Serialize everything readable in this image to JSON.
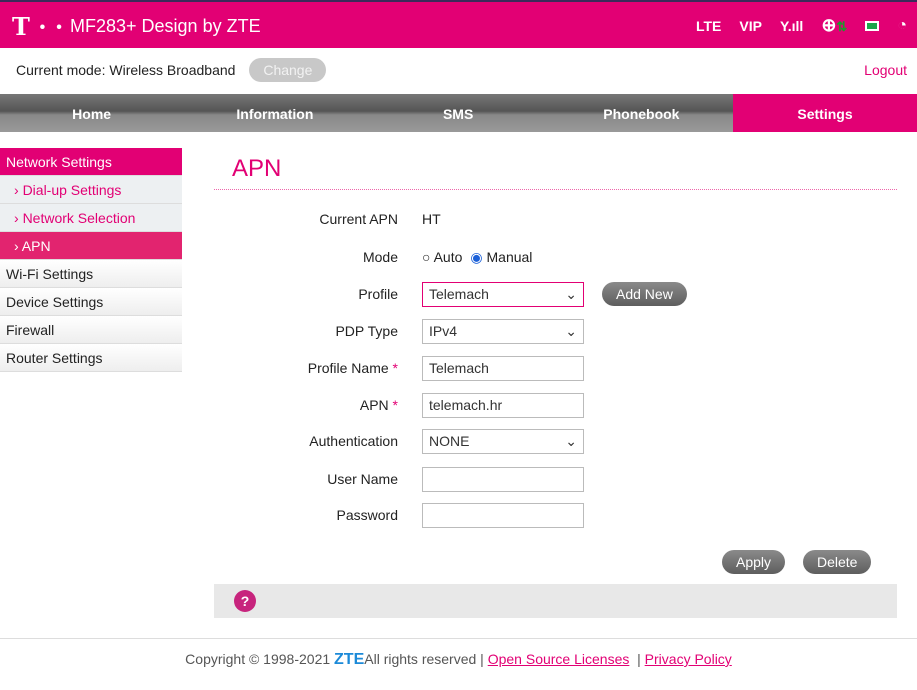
{
  "header": {
    "logo": "T · ·",
    "title": "MF283+ Design by ZTE",
    "network": "LTE",
    "operator": "VIP",
    "icons": [
      "signal-icon",
      "internet-globe-icon",
      "data-arrows-icon",
      "sim-icon",
      "wifi-icon"
    ]
  },
  "modebar": {
    "label": "Current mode: Wireless Broadband",
    "change": "Change",
    "logout": "Logout"
  },
  "nav": [
    "Home",
    "Information",
    "SMS",
    "Phonebook",
    "Settings"
  ],
  "sidebar": {
    "header": "Network Settings",
    "subs": [
      "Dial-up Settings",
      "Network Selection",
      "APN"
    ],
    "items": [
      "Wi-Fi Settings",
      "Device Settings",
      "Firewall",
      "Router Settings"
    ]
  },
  "page": {
    "title": "APN",
    "current_apn_label": "Current APN",
    "current_apn": "HT",
    "mode_label": "Mode",
    "mode_auto": "Auto",
    "mode_manual": "Manual",
    "profile_label": "Profile",
    "profile": "Telemach",
    "add_new": "Add New",
    "pdp_label": "PDP Type",
    "pdp": "IPv4",
    "profile_name_label": "Profile Name",
    "profile_name": "Telemach",
    "apn_label": "APN",
    "apn": "telemach.hr",
    "auth_label": "Authentication",
    "auth": "NONE",
    "user_label": "User Name",
    "user": "",
    "password_label": "Password",
    "password": "",
    "apply": "Apply",
    "delete": "Delete",
    "required": "*"
  },
  "footer": {
    "copyright": "Copyright © 1998-2021",
    "brand": "ZTE",
    "rights": "All rights reserved  |",
    "oss": "Open Source Licenses",
    "sep": "|",
    "privacy": "Privacy Policy"
  }
}
